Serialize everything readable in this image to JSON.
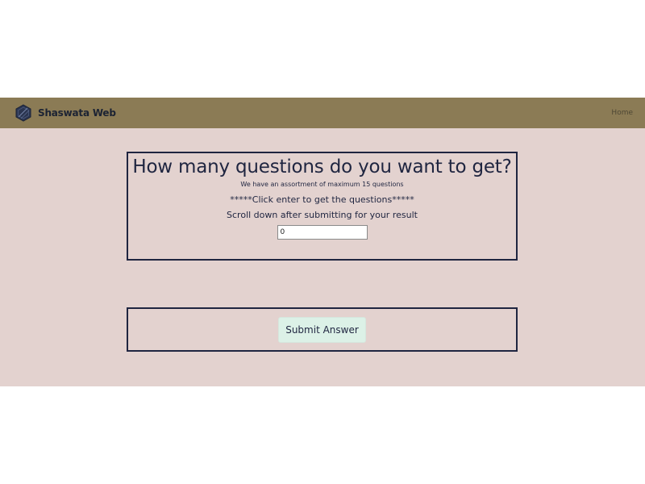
{
  "navbar": {
    "brand_name": "Shaswata Web",
    "logo_icon": "hexagon-logo-icon",
    "home_link": "Home",
    "background_color": "#8b7b55"
  },
  "page": {
    "background_color": "#e3d2cf"
  },
  "question_box": {
    "title": "How many questions do you want to get?",
    "subtitle": "We have an assortment of maximum 15 questions",
    "instruction": "*****Click enter to get the questions*****",
    "scroll_note": "Scroll down after submitting for your result",
    "input_value": "0"
  },
  "submit": {
    "label": "Submit Answer",
    "button_color": "#dcf1e7"
  }
}
